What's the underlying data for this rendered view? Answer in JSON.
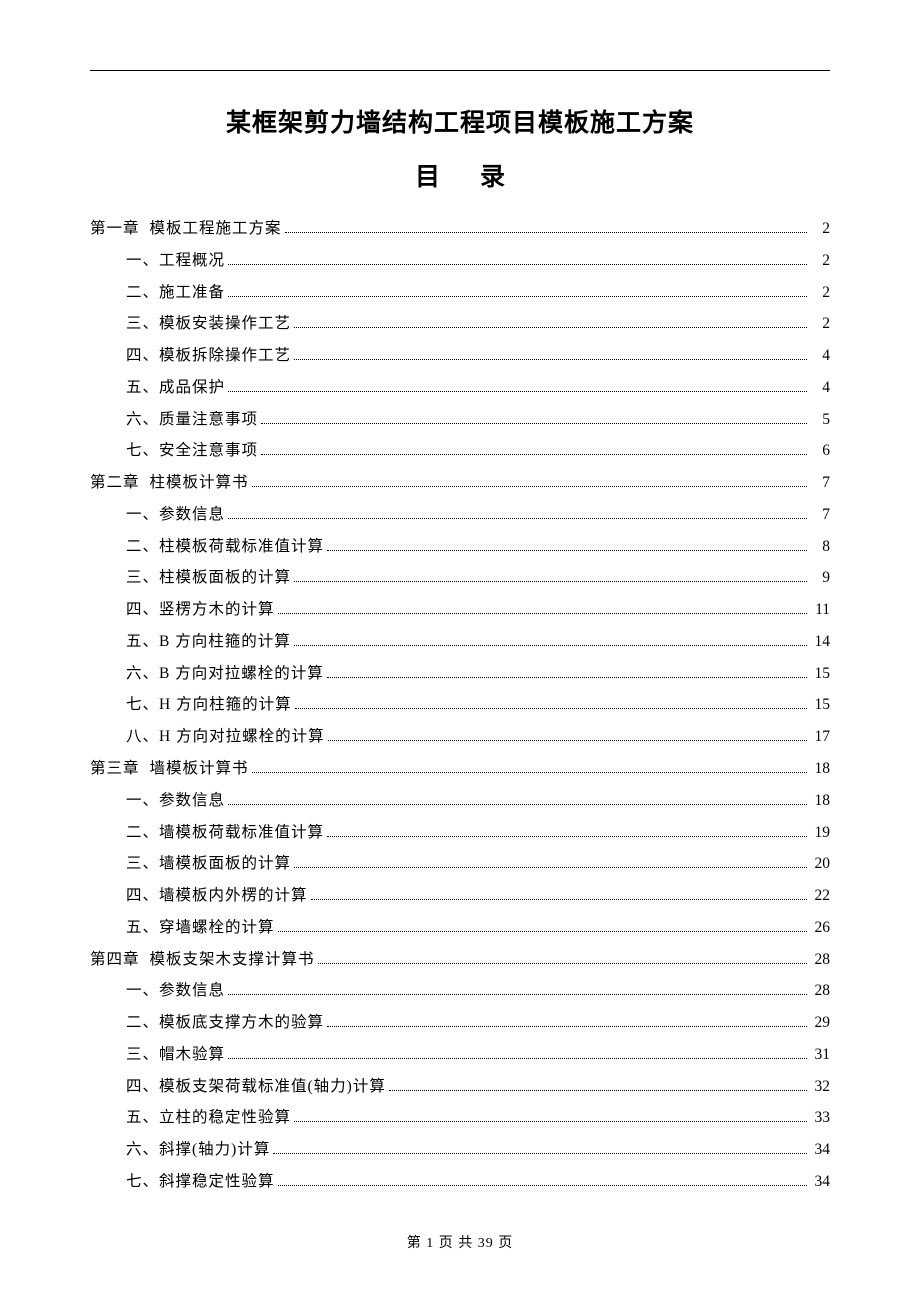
{
  "title": "某框架剪力墙结构工程项目模板施工方案",
  "toc_heading_left": "目",
  "toc_heading_right": "录",
  "toc": [
    {
      "level": 1,
      "label": "第一章",
      "text": "模板工程施工方案",
      "page": "2"
    },
    {
      "level": 2,
      "label": "一、",
      "text": "工程概况",
      "page": "2"
    },
    {
      "level": 2,
      "label": "二、",
      "text": "施工准备",
      "page": "2"
    },
    {
      "level": 2,
      "label": "三、",
      "text": "模板安装操作工艺",
      "page": "2"
    },
    {
      "level": 2,
      "label": "四、",
      "text": "模板拆除操作工艺",
      "page": "4"
    },
    {
      "level": 2,
      "label": "五、",
      "text": "成品保护",
      "page": "4"
    },
    {
      "level": 2,
      "label": "六、",
      "text": "质量注意事项",
      "page": "5"
    },
    {
      "level": 2,
      "label": "七、",
      "text": "安全注意事项",
      "page": "6"
    },
    {
      "level": 1,
      "label": "第二章",
      "text": "柱模板计算书",
      "page": "7"
    },
    {
      "level": 2,
      "label": "一、",
      "text": "参数信息",
      "page": "7"
    },
    {
      "level": 2,
      "label": "二、",
      "text": "柱模板荷载标准值计算",
      "page": "8"
    },
    {
      "level": 2,
      "label": "三、",
      "text": "柱模板面板的计算",
      "page": "9"
    },
    {
      "level": 2,
      "label": "四、",
      "text": "竖楞方木的计算",
      "page": "11"
    },
    {
      "level": 2,
      "label": "五、",
      "text": "B 方向柱箍的计算",
      "page": "14"
    },
    {
      "level": 2,
      "label": "六、",
      "text": "B 方向对拉螺栓的计算",
      "page": "15"
    },
    {
      "level": 2,
      "label": "七、",
      "text": "H 方向柱箍的计算",
      "page": "15"
    },
    {
      "level": 2,
      "label": "八、",
      "text": "H 方向对拉螺栓的计算",
      "page": "17"
    },
    {
      "level": 1,
      "label": "第三章",
      "text": "墙模板计算书",
      "page": "18"
    },
    {
      "level": 2,
      "label": "一、",
      "text": "参数信息",
      "page": "18"
    },
    {
      "level": 2,
      "label": "二、",
      "text": "墙模板荷载标准值计算",
      "page": "19"
    },
    {
      "level": 2,
      "label": "三、",
      "text": "墙模板面板的计算",
      "page": "20"
    },
    {
      "level": 2,
      "label": "四、",
      "text": "墙模板内外楞的计算",
      "page": "22"
    },
    {
      "level": 2,
      "label": "五、",
      "text": "穿墙螺栓的计算",
      "page": "26"
    },
    {
      "level": 1,
      "label": "第四章",
      "text": "模板支架木支撑计算书",
      "page": "28"
    },
    {
      "level": 2,
      "label": "一、",
      "text": "参数信息",
      "page": "28"
    },
    {
      "level": 2,
      "label": "二、",
      "text": "模板底支撑方木的验算",
      "page": "29"
    },
    {
      "level": 2,
      "label": "三、",
      "text": "帽木验算",
      "page": "31"
    },
    {
      "level": 2,
      "label": "四、",
      "text": "模板支架荷载标准值(轴力)计算",
      "page": "32"
    },
    {
      "level": 2,
      "label": "五、",
      "text": "立柱的稳定性验算",
      "page": "33"
    },
    {
      "level": 2,
      "label": "六、",
      "text": "斜撑(轴力)计算",
      "page": "34"
    },
    {
      "level": 2,
      "label": "七、",
      "text": "斜撑稳定性验算",
      "page": "34"
    }
  ],
  "footer": "第 1 页    共 39 页"
}
